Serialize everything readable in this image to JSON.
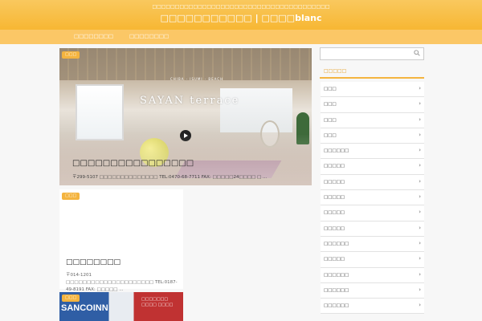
{
  "header": {
    "tagline": "□□□□□□□□□□□□□□□□□□□□□□□□□□□□□□□□□□□□□□□",
    "site_title": "□□□□□□□□□□□ | □□□□blanc"
  },
  "nav": {
    "items": [
      "□□□□□□□□",
      "□□□□□□□□"
    ]
  },
  "featured": {
    "badge": "□□□",
    "image_logo": "SAYAN terrace",
    "image_logo_sub": "CHIBA · ISUMI · BEACH",
    "title": "□□□□□□□□□□□□□□□□",
    "excerpt": "〒299-5107 □□□□□□□□□□□□□□ TEL:0470-68-7711 FAX: □□□□□24□□□□ □ ..."
  },
  "cards": [
    {
      "badge": "□□□",
      "title": "□□□□□□□□",
      "excerpt": "〒014-1201 □□□□□□□□□□□□□□□□□□□□□ TEL:0187-49-8191 FAX: □□□□□ ..."
    },
    {
      "badge": "□□□",
      "image_logo": "SANCOINN",
      "image_text": "□□□□□□□ □□□□ □□□□"
    }
  ],
  "sidebar": {
    "search": {
      "placeholder": ""
    },
    "heading": "□□□□□",
    "items": [
      "□□□",
      "□□□",
      "□□□",
      "□□□",
      "□□□□□□",
      "□□□□□",
      "□□□□□",
      "□□□□□",
      "□□□□□",
      "□□□□□",
      "□□□□□□",
      "□□□□□",
      "□□□□□□",
      "□□□□□□",
      "□□□□□□"
    ]
  },
  "colors": {
    "accent": "#f4b43f",
    "header_top": "#f9c85e",
    "nav": "#fbc766"
  },
  "icons": {
    "search": "search-icon",
    "chevron": "chevron-right-icon",
    "play": "play-icon"
  }
}
